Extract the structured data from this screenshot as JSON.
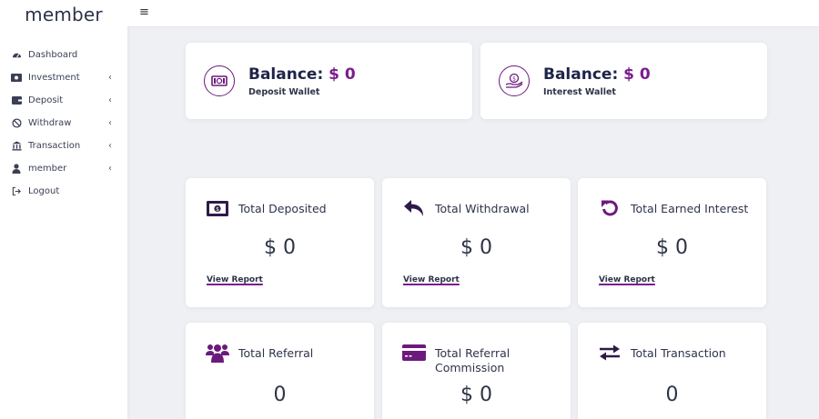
{
  "brand": "member",
  "accent": "#7b1d8f",
  "sidebar": {
    "items": [
      {
        "label": "Dashboard",
        "icon": "dashboard-icon",
        "has_submenu": false
      },
      {
        "label": "Investment",
        "icon": "money-icon",
        "has_submenu": true
      },
      {
        "label": "Deposit",
        "icon": "wallet-icon",
        "has_submenu": true
      },
      {
        "label": "Withdraw",
        "icon": "ban-icon",
        "has_submenu": true
      },
      {
        "label": "Transaction",
        "icon": "bank-icon",
        "has_submenu": true
      },
      {
        "label": "member",
        "icon": "user-icon",
        "has_submenu": true
      },
      {
        "label": "Logout",
        "icon": "logout-icon",
        "has_submenu": false
      }
    ],
    "chevron": "‹"
  },
  "topbar": {
    "menu_icon": "≡"
  },
  "wallets": [
    {
      "label": "Balance:",
      "amount": "$ 0",
      "sub": "Deposit Wallet",
      "icon": "cash-icon"
    },
    {
      "label": "Balance:",
      "amount": "$ 0",
      "sub": "Interest Wallet",
      "icon": "coin-hand-icon"
    }
  ],
  "stats": [
    {
      "title": "Total Deposited",
      "value": "$ 0",
      "link": "View Report",
      "icon": "cash-icon"
    },
    {
      "title": "Total Withdrawal",
      "value": "$ 0",
      "link": "View Report",
      "icon": "reply-arrow-icon"
    },
    {
      "title": "Total Earned Interest",
      "value": "$ 0",
      "link": "View Report",
      "icon": "undo-icon"
    },
    {
      "title": "Total Referral",
      "value": "0",
      "icon": "users-icon"
    },
    {
      "title": "Total Referral Commission",
      "value": "$ 0",
      "icon": "credit-card-icon"
    },
    {
      "title": "Total Transaction",
      "value": "0",
      "icon": "exchange-icon"
    }
  ]
}
